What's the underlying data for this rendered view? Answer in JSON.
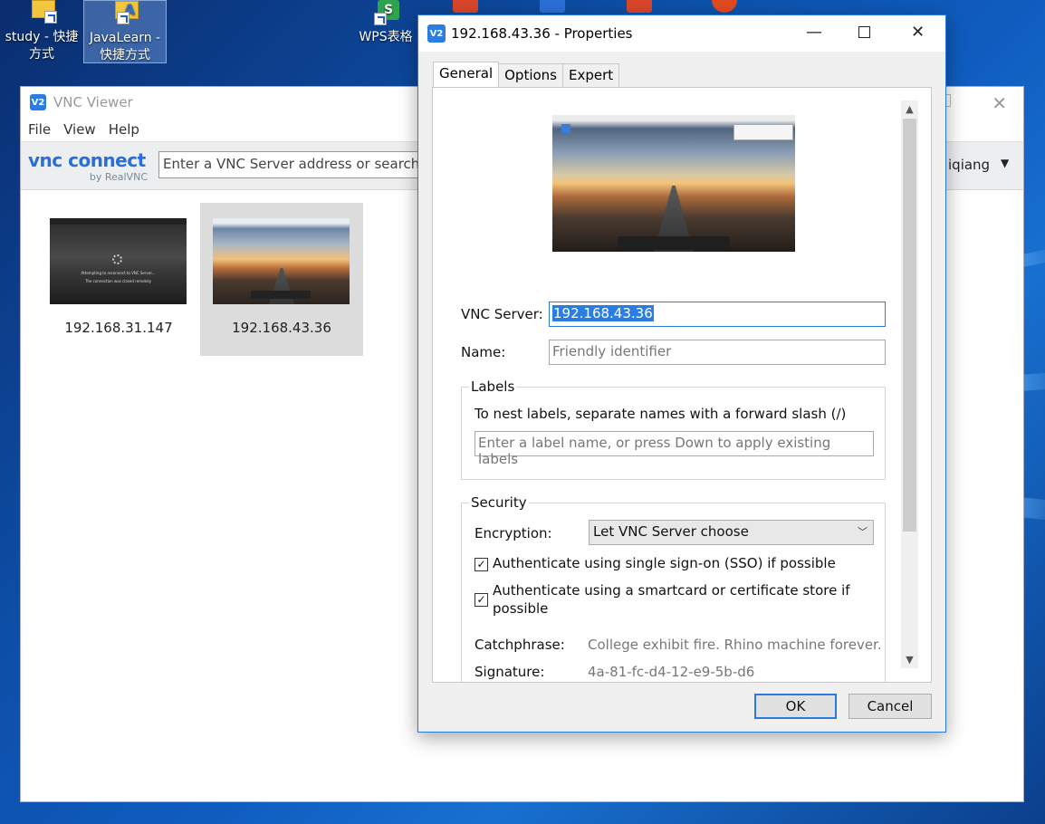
{
  "desktop": {
    "icons": [
      {
        "name": "study-shortcut",
        "label": "study - 快捷方式"
      },
      {
        "name": "javalearn-shortcut",
        "label": "JavaLearn - 快捷方式"
      },
      {
        "name": "wps-spreadsheet",
        "label": "WPS表格"
      }
    ]
  },
  "main_window": {
    "title": "VNC Viewer",
    "menu": [
      "File",
      "View",
      "Help"
    ],
    "brand_logo": "vnc connect",
    "brand_sub": "by RealVNC",
    "search_placeholder": "Enter a VNC Server address or search",
    "user_name": "iqiang",
    "connections": [
      {
        "label": "192.168.31.147",
        "selected": false
      },
      {
        "label": "192.168.43.36",
        "selected": true
      }
    ],
    "thumb1_msg1": "Attempting to reconnect to VNC Server...",
    "thumb1_msg2": "The connection was closed remotely"
  },
  "dialog": {
    "title": "192.168.43.36 - Properties",
    "tabs": [
      {
        "label": "General",
        "active": true
      },
      {
        "label": "Options",
        "active": false
      },
      {
        "label": "Expert",
        "active": false
      }
    ],
    "vnc_server_label": "VNC Server:",
    "vnc_server_value": "192.168.43.36",
    "name_label": "Name:",
    "name_placeholder": "Friendly identifier",
    "labels_group": "Labels",
    "labels_hint": "To nest labels, separate names with a forward slash (/)",
    "labels_placeholder": "Enter a label name, or press Down to apply existing labels",
    "security_group": "Security",
    "encryption_label": "Encryption:",
    "encryption_value": "Let VNC Server choose",
    "sso_label": "Authenticate using single sign-on (SSO) if possible",
    "sso_checked": true,
    "smartcard_label_1": "Authenticate using a smartcard or certificate store if",
    "smartcard_label_2": "possible",
    "smartcard_checked": true,
    "catchphrase_label": "Catchphrase:",
    "catchphrase_value": "College exhibit fire. Rhino machine forever.",
    "signature_label": "Signature:",
    "signature_value": "4a-81-fc-d4-12-e9-5b-d6",
    "ok_label": "OK",
    "cancel_label": "Cancel"
  },
  "colors": {
    "accent": "#2b79d9",
    "desktop_blue": "#0d4fa8"
  }
}
